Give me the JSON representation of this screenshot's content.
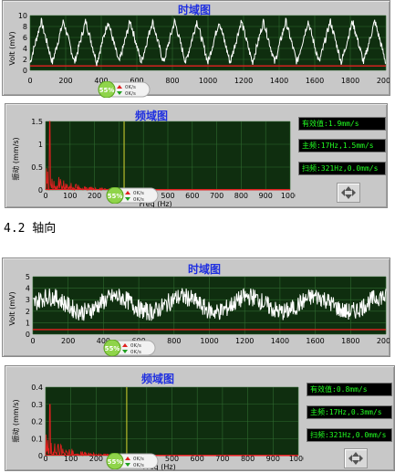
{
  "colors": {
    "plot_bg": "#0f2e0f",
    "grid": "#2f6a2f",
    "trace": "#ffffff",
    "baseline": "#e62020",
    "spectrum": "#e02020",
    "cursor": "#d8d830",
    "title": "#1f2fe0",
    "readout_text": "#22ff22"
  },
  "section_heading": "4.2 轴向",
  "gauge": {
    "percent_label": "55%",
    "up_rate": "0K/s",
    "down_rate": "0K/s"
  },
  "icons": {
    "nav": "four-direction-arrows-icon",
    "up": "arrow-up-icon",
    "down": "arrow-down-icon"
  },
  "panels": [
    {
      "id": "radial-time",
      "title": "时域图",
      "ylabel": "Volt (mV)",
      "xlabel": "",
      "xticks": [
        "0",
        "200",
        "400",
        "600",
        "800",
        "1000",
        "1200",
        "1400",
        "1600",
        "1800",
        "2000"
      ],
      "yticks": [
        "0",
        "2",
        "4",
        "6",
        "8",
        "10"
      ],
      "chart_data": {
        "type": "line",
        "x_range": [
          0,
          2000
        ],
        "ylim": [
          0,
          10
        ],
        "baseline": 0.8,
        "signal": "periodic",
        "approx_cycles": 16,
        "mean": 5.2,
        "amplitude": 3.8,
        "grid": true
      }
    },
    {
      "id": "radial-freq",
      "title": "频域图",
      "ylabel": "振动 (mm/s)",
      "xlabel": "Freq (Hz)",
      "xticks": [
        "0",
        "100",
        "200",
        "300",
        "400",
        "500",
        "600",
        "700",
        "800",
        "900",
        "1000"
      ],
      "yticks": [
        "0",
        "0.5",
        "1",
        "1.5"
      ],
      "readouts": [
        "有效值:1.9mm/s",
        "主频:17Hz,1.5mm/s",
        "扫频:321Hz,0.0mm/s"
      ],
      "chart_data": {
        "type": "line",
        "x_range": [
          0,
          1000
        ],
        "ylim": [
          0,
          1.5
        ],
        "peak": {
          "x": 17,
          "y": 1.5
        },
        "cursor_x": 321,
        "grid": true
      }
    },
    {
      "id": "axial-time",
      "title": "时域图",
      "ylabel": "Volt (mV)",
      "xlabel": "",
      "xticks": [
        "0",
        "200",
        "400",
        "600",
        "800",
        "1000",
        "1200",
        "1400",
        "1600",
        "1800",
        "2000"
      ],
      "yticks": [
        "0",
        "1",
        "2",
        "3",
        "4",
        "5"
      ],
      "chart_data": {
        "type": "line",
        "x_range": [
          0,
          2000
        ],
        "ylim": [
          0,
          5
        ],
        "baseline": 0.4,
        "signal": "noisy",
        "mean": 2.6,
        "amplitude": 1.1,
        "grid": true
      }
    },
    {
      "id": "axial-freq",
      "title": "频域图",
      "ylabel": "振动 (mm/s)",
      "xlabel": "Freq (Hz)",
      "xticks": [
        "0",
        "100",
        "200",
        "300",
        "400",
        "500",
        "600",
        "700",
        "800",
        "900",
        "1000"
      ],
      "yticks": [
        "0",
        "0.1",
        "0.2",
        "0.3",
        "0.4"
      ],
      "readouts": [
        "有效值:0.8mm/s",
        "主频:17Hz,0.3mm/s",
        "扫频:321Hz,0.0mm/s"
      ],
      "chart_data": {
        "type": "line",
        "x_range": [
          0,
          1000
        ],
        "ylim": [
          0,
          0.4
        ],
        "peak": {
          "x": 17,
          "y": 0.3
        },
        "cursor_x": 321,
        "grid": true
      }
    }
  ]
}
